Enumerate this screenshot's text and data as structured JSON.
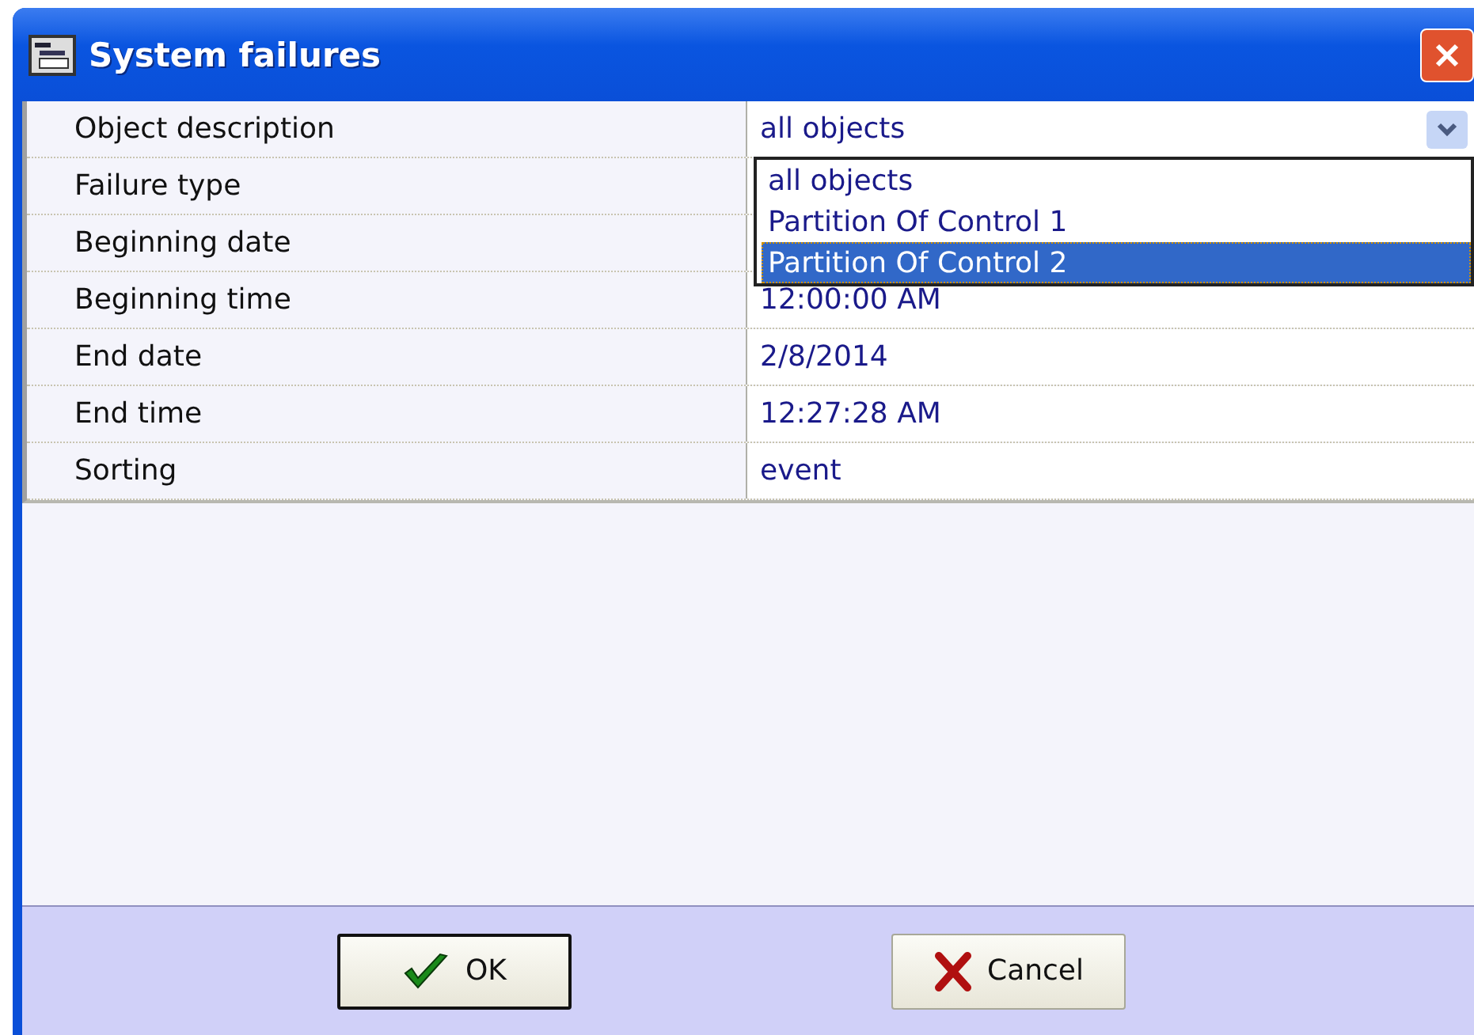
{
  "window": {
    "title": "System failures"
  },
  "properties": [
    {
      "label": "Object description",
      "value": "all objects",
      "kind": "dropdown"
    },
    {
      "label": "Failure type",
      "kind": "text"
    },
    {
      "label": "Beginning date",
      "kind": "text"
    },
    {
      "label": "Beginning time",
      "value": "12:00:00 AM",
      "kind": "text"
    },
    {
      "label": "End date",
      "value": "2/8/2014",
      "kind": "text"
    },
    {
      "label": "End time",
      "value": "12:27:28 AM",
      "kind": "text"
    },
    {
      "label": "Sorting",
      "value": "event",
      "kind": "text"
    }
  ],
  "dropdown_list": {
    "expanded": true,
    "options": [
      {
        "label": "all objects",
        "selected": false
      },
      {
        "label": "Partition Of Control 1",
        "selected": false
      },
      {
        "label": "Partition Of Control 2",
        "selected": true
      }
    ]
  },
  "buttons": [
    {
      "label": "OK",
      "kind": "ok",
      "default": true
    },
    {
      "label": "Cancel",
      "kind": "cancel",
      "default": false
    }
  ]
}
